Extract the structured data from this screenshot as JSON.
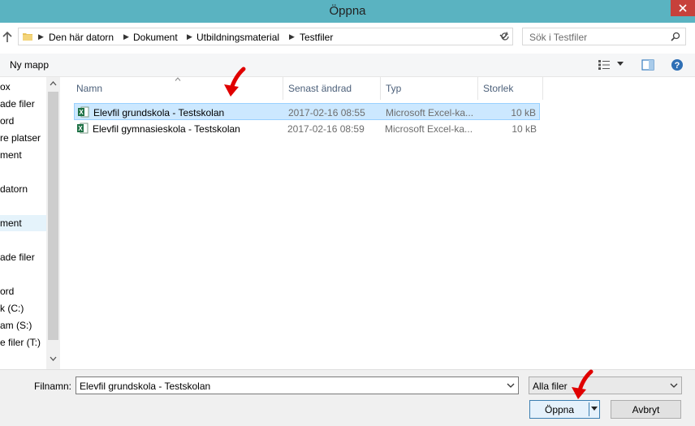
{
  "window": {
    "title": "Öppna"
  },
  "address": {
    "crumbs": [
      "Den här datorn",
      "Dokument",
      "Utbildningsmaterial",
      "Testfiler"
    ]
  },
  "search": {
    "placeholder": "Sök i Testfiler"
  },
  "toolbar": {
    "new_folder": "Ny mapp"
  },
  "nav_items": [
    {
      "label": "ox",
      "selected": false
    },
    {
      "label": "ade filer",
      "selected": false
    },
    {
      "label": "ord",
      "selected": false
    },
    {
      "label": "re platser",
      "selected": false
    },
    {
      "label": "ment",
      "selected": false
    },
    {
      "label": "datorn",
      "selected": false
    },
    {
      "label": "ment",
      "selected": true
    },
    {
      "label": "ade filer",
      "selected": false
    },
    {
      "label": "ord",
      "selected": false
    },
    {
      "label": "k (C:)",
      "selected": false
    },
    {
      "label": "am (S:)",
      "selected": false
    },
    {
      "label": "e filer (T:)",
      "selected": false
    }
  ],
  "columns": {
    "name": "Namn",
    "modified": "Senast ändrad",
    "type": "Typ",
    "size": "Storlek"
  },
  "files": [
    {
      "name": "Elevfil grundskola - Testskolan",
      "modified": "2017-02-16 08:55",
      "type": "Microsoft Excel-ka...",
      "size": "10 kB",
      "selected": true
    },
    {
      "name": "Elevfil gymnasieskola - Testskolan",
      "modified": "2017-02-16 08:59",
      "type": "Microsoft Excel-ka...",
      "size": "10 kB",
      "selected": false
    }
  ],
  "bottom": {
    "filename_label": "Filnamn:",
    "filename_value": "Elevfil grundskola - Testskolan",
    "filetype_value": "Alla filer",
    "open_label": "Öppna",
    "cancel_label": "Avbryt"
  },
  "colors": {
    "titlebar": "#5ab3c1",
    "close": "#c7413b",
    "selection": "#cce8ff",
    "annotation_arrow": "#e00000",
    "excel_green": "#1e7145"
  }
}
